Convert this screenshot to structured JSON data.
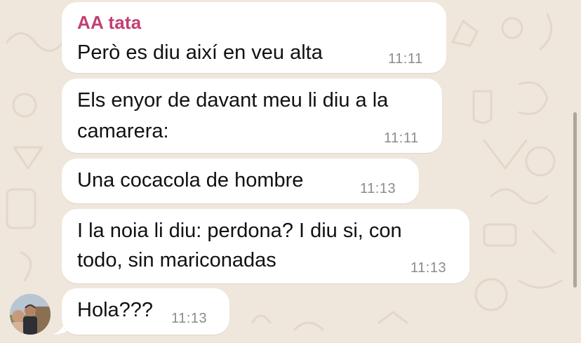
{
  "chat": {
    "sender_name": "AA tata",
    "messages": [
      {
        "lines": [
          "Però es diu així en veu alta"
        ],
        "time": "11:11"
      },
      {
        "lines": [
          "Els enyor de davant meu li diu a la",
          "camarera:"
        ],
        "time": "11:11"
      },
      {
        "lines": [
          "Una cocacola de hombre"
        ],
        "time": "11:13"
      },
      {
        "lines": [
          "I la noia li diu: perdona? I diu si, con",
          "todo, sin mariconadas"
        ],
        "time": "11:13"
      },
      {
        "lines": [
          "Hola???"
        ],
        "time": "11:13"
      }
    ]
  },
  "colors": {
    "sender": "#c13f74",
    "bubble": "#ffffff",
    "wallpaper": "#efe7dc",
    "timestamp": "#8c8c8c"
  },
  "icons": {
    "avatar": "contact-avatar-photo"
  }
}
